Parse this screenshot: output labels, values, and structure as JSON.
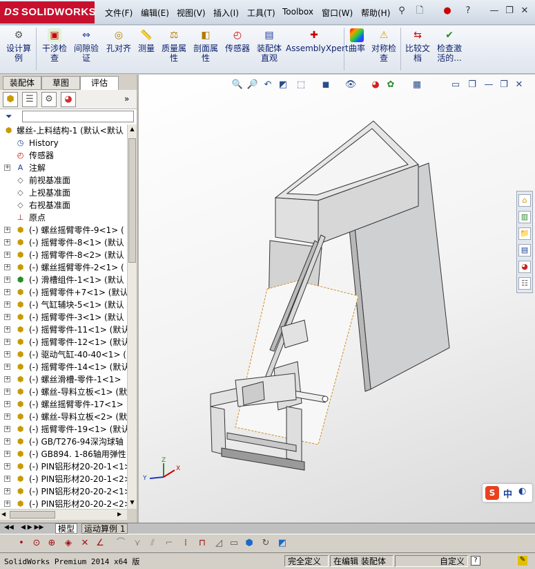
{
  "app": {
    "brand": "SOLIDWORKS",
    "brand_prefix": "DS"
  },
  "menu": [
    "文件(F)",
    "编辑(E)",
    "视图(V)",
    "插入(I)",
    "工具(T)",
    "Toolbox",
    "窗口(W)",
    "帮助(H)"
  ],
  "commands": [
    {
      "label": "设计算\n例",
      "icon": "design-study-icon"
    },
    {
      "label": "干涉检\n查",
      "icon": "interference-check-icon"
    },
    {
      "label": "间隙验\n证",
      "icon": "clearance-verify-icon"
    },
    {
      "label": "孔对齐",
      "icon": "hole-align-icon"
    },
    {
      "label": "测量",
      "icon": "measure-icon"
    },
    {
      "label": "质量属\n性",
      "icon": "mass-properties-icon"
    },
    {
      "label": "剖面属\n性",
      "icon": "section-properties-icon"
    },
    {
      "label": "传感器",
      "icon": "sensor-icon"
    },
    {
      "label": "装配体\n直观",
      "icon": "assembly-visualization-icon"
    },
    {
      "label": "AssemblyXpert",
      "icon": "assemblyxpert-icon"
    },
    {
      "label": "曲率",
      "icon": "curvature-icon"
    },
    {
      "label": "对称检\n查",
      "icon": "symmetry-check-icon"
    },
    {
      "label": "比较文\n档",
      "icon": "compare-documents-icon"
    },
    {
      "label": "检查激\n活的...",
      "icon": "check-active-icon"
    }
  ],
  "panel_tabs": [
    "装配体",
    "草图",
    "评估"
  ],
  "tree": {
    "root": "螺丝-上料结构-1  (默认<默认",
    "items": [
      {
        "label": "History",
        "type": "history"
      },
      {
        "label": "传感器",
        "type": "sensor"
      },
      {
        "label": "注解",
        "type": "annotation",
        "expand": true
      },
      {
        "label": "前视基准面",
        "type": "plane"
      },
      {
        "label": "上视基准面",
        "type": "plane"
      },
      {
        "label": "右视基准面",
        "type": "plane"
      },
      {
        "label": "原点",
        "type": "origin"
      },
      {
        "label": "(-) 螺丝摇臂零件-9<1>  (",
        "type": "part",
        "expand": true
      },
      {
        "label": "(-) 摇臂零件-8<1>  (默认",
        "type": "part",
        "expand": true
      },
      {
        "label": "(-) 摇臂零件-8<2>  (默认",
        "type": "part",
        "expand": true
      },
      {
        "label": "(-) 螺丝摇臂零件-2<1>  (",
        "type": "part",
        "expand": true
      },
      {
        "label": "(-) 滑槽组件-1<1>  (默认",
        "type": "assy",
        "expand": true
      },
      {
        "label": "(-) 摇臂零件+7<1>  (默认",
        "type": "part",
        "expand": true
      },
      {
        "label": "(-) 气缸辅块-5<1>  (默认",
        "type": "part",
        "expand": true
      },
      {
        "label": "(-) 摇臂零件-3<1>  (默认",
        "type": "part",
        "expand": true
      },
      {
        "label": "(-) 摇臂零件-11<1>  (默认",
        "type": "part",
        "expand": true
      },
      {
        "label": "(-) 摇臂零件-12<1>  (默认",
        "type": "part",
        "expand": true
      },
      {
        "label": "(-) 驱动气缸-40-40<1>  (",
        "type": "part",
        "expand": true
      },
      {
        "label": "(-) 摇臂零件-14<1>  (默认",
        "type": "part",
        "expand": true
      },
      {
        "label": "(-) 螺丝滑槽-零件-1<1>",
        "type": "part",
        "expand": true
      },
      {
        "label": "(-) 螺丝-导料立板<1>  (默",
        "type": "part",
        "expand": true
      },
      {
        "label": "(-) 螺丝摇臂零件-17<1>",
        "type": "part",
        "expand": true
      },
      {
        "label": "(-) 螺丝-导料立板<2>  (默",
        "type": "part",
        "expand": true
      },
      {
        "label": "(-) 摇臂零件-19<1>  (默认",
        "type": "part",
        "expand": true
      },
      {
        "label": "(-) GB/T276-94深沟球轴",
        "type": "part",
        "expand": true
      },
      {
        "label": "(-) GB894. 1-86轴用弹性",
        "type": "part",
        "expand": true
      },
      {
        "label": "(-) PIN铝形材20-20-1<1>",
        "type": "part",
        "expand": true
      },
      {
        "label": "(-) PIN铝形材20-20-1<2>",
        "type": "part",
        "expand": true
      },
      {
        "label": "(-) PIN铝形材20-20-2<1>",
        "type": "part",
        "expand": true
      },
      {
        "label": "(-) PIN铝形材20-20-2<2>",
        "type": "part",
        "expand": true
      }
    ]
  },
  "bottom_tabs": [
    "模型",
    "运动算例 1"
  ],
  "status": {
    "app": "SolidWorks Premium 2014 x64 版",
    "fully_defined": "完全定义",
    "editing": "在编辑 装配体",
    "custom": "自定义"
  },
  "ime": {
    "lang": "中"
  }
}
